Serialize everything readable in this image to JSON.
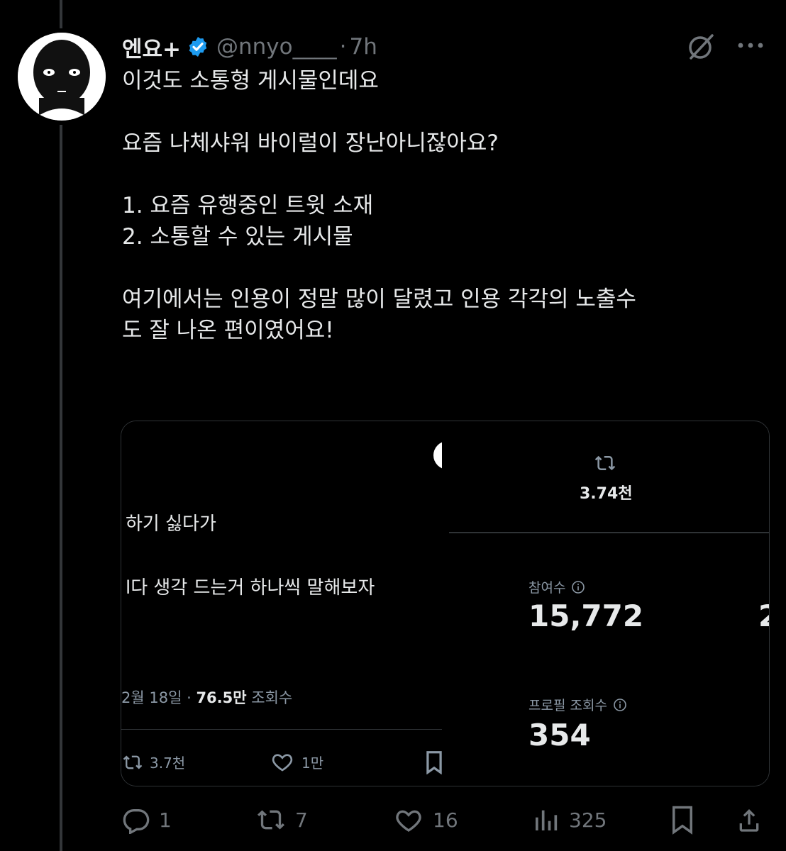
{
  "post": {
    "display_name": "엔요+",
    "handle": "@nnyo____",
    "separator": "·",
    "time": "7h",
    "body": [
      "이것도 소통형 게시물인데요",
      "",
      "요즘 나체샤워 바이럴이 장난아니잖아요?",
      "",
      "1. 요즘 유행중인 트윗 소재",
      "2. 소통할 수 있는 게시물",
      "",
      "여기에서는 인용이 정말 많이 달렸고 인용 각각의 노출수",
      "도 잘 나온 편이였어요!"
    ]
  },
  "media": {
    "left": {
      "line1": "하기 싫다가",
      "line2": "l다 생각 드는거 하나씩 말해보자",
      "meta_date": "2월 18일 · ",
      "meta_views_value": "76.5만",
      "meta_views_label": " 조회수",
      "retweet_count": "3.7천",
      "like_count": "1만"
    },
    "right": {
      "retweet_count": "3.74천",
      "engagements_label": "참여수",
      "engagements_value": "15,772",
      "profile_views_label": "프로필 조회수",
      "profile_views_value": "354",
      "cut_text": "2"
    }
  },
  "actions": {
    "reply_count": "1",
    "repost_count": "7",
    "like_count": "16",
    "views_count": "325"
  },
  "colors": {
    "verified": "#1d9bf0",
    "muted": "#71767b",
    "text": "#e7e9ea"
  },
  "icons": [
    "verified-badge-icon",
    "grok-icon",
    "more-icon",
    "retweet-icon",
    "heart-icon",
    "bookmark-icon",
    "reply-icon",
    "views-icon",
    "share-icon",
    "info-icon"
  ]
}
